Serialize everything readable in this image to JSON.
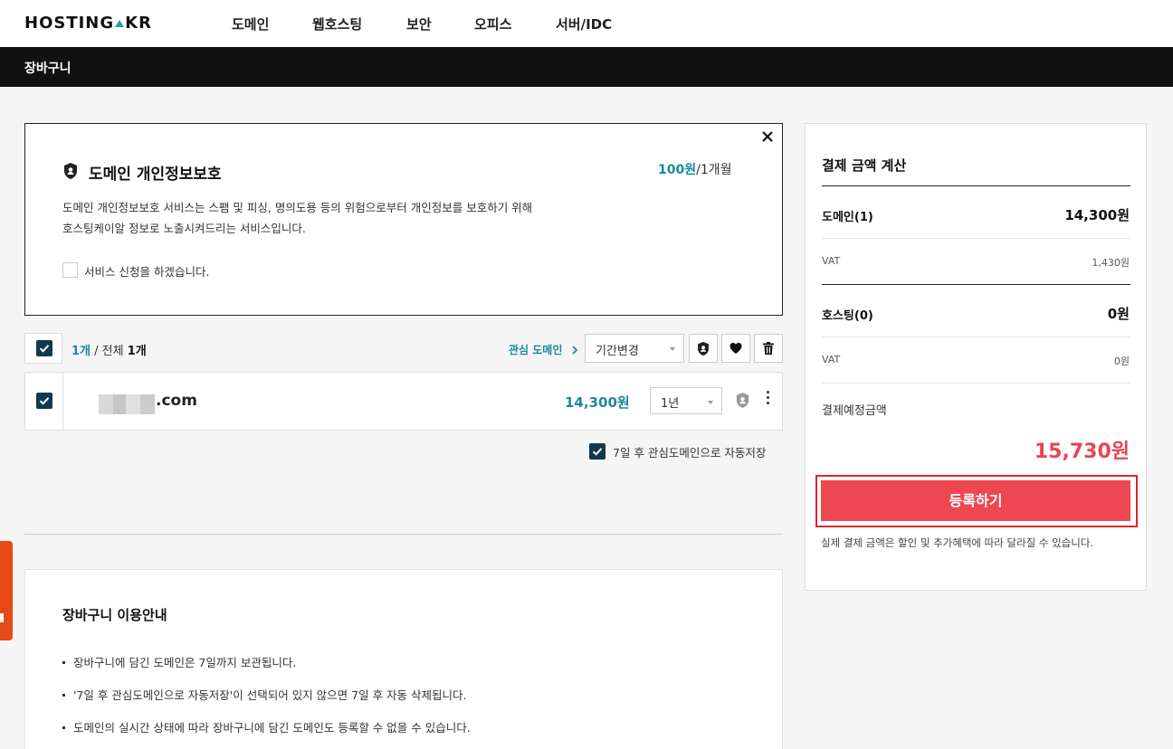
{
  "header": {
    "logo": {
      "left": "HOSTING",
      "right": "KR"
    },
    "nav": [
      "도메인",
      "웹호스팅",
      "보안",
      "오피스",
      "서버/IDC"
    ]
  },
  "page_title": "장바구니",
  "privacy": {
    "close_label": "×",
    "title": "도메인 개인정보보호",
    "price": "100원",
    "period": "/1개월",
    "desc_line1": "도메인 개인정보보호 서비스는 스팸 및 피싱, 명의도용 등의 위험으로부터 개인정보를 보호하기 위해",
    "desc_line2": "호스팅케이알 정보로 노출시켜드리는 서비스입니다.",
    "checkbox_label": "서비스 신청을 하겠습니다."
  },
  "toolbar": {
    "selected": "1개",
    "separator": " / 전체 ",
    "total": "1개",
    "watch_link": "관심 도메인",
    "period_select": "기간변경"
  },
  "domain_row": {
    "tld": ".com",
    "price": "14,300원",
    "period": "1년"
  },
  "autosave_label": "7일 후 관심도메인으로 자동저장",
  "guide": {
    "title": "장바구니 이용안내",
    "items": [
      "장바구니에 담긴 도메인은 7일까지 보관됩니다.",
      "'7일 후 관심도메인으로 자동저장'이 선택되어 있지 않으면 7일 후 자동 삭제됩니다.",
      "도메인의 실시간 상태에 따라 장바구니에 담긴 도메인도 등록할 수 없을 수 있습니다."
    ]
  },
  "payment": {
    "title": "결제 금액 계산",
    "domain_label": "도메인(1)",
    "domain_value": "14,300원",
    "vat_label": "VAT",
    "domain_vat": "1,430원",
    "hosting_label": "호스팅(0)",
    "hosting_value": "0원",
    "hosting_vat": "0원",
    "total_label": "결제예정금액",
    "total_value": "15,730원",
    "register_button": "등록하기",
    "note": "실제 결제 금액은 할인 및 추가혜택에 따라 달라질 수 있습니다."
  },
  "colors": {
    "accent_teal": "#1a8a99",
    "checkbox_navy": "#13384c",
    "register_red": "#ee4751",
    "total_red": "#e84552",
    "side_tab_orange": "#e64a19"
  },
  "icons": [
    "shield-icon",
    "heart-icon",
    "trash-icon",
    "chevron-right-icon",
    "close-icon",
    "more-vertical-icon",
    "check-icon"
  ]
}
